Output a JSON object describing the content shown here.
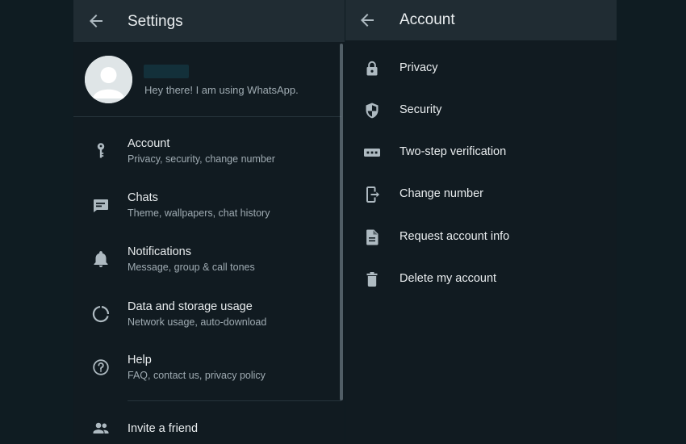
{
  "settings": {
    "title": "Settings",
    "profile": {
      "status": "Hey there! I am using WhatsApp."
    },
    "items": [
      {
        "icon": "key-icon",
        "title": "Account",
        "subtitle": "Privacy, security, change number"
      },
      {
        "icon": "chat-icon",
        "title": "Chats",
        "subtitle": "Theme, wallpapers, chat history"
      },
      {
        "icon": "bell-icon",
        "title": "Notifications",
        "subtitle": "Message, group & call tones"
      },
      {
        "icon": "data-usage-icon",
        "title": "Data and storage usage",
        "subtitle": "Network usage, auto-download"
      },
      {
        "icon": "help-icon",
        "title": "Help",
        "subtitle": "FAQ, contact us, privacy policy"
      }
    ],
    "invite": {
      "icon": "people-icon",
      "title": "Invite a friend"
    }
  },
  "account": {
    "title": "Account",
    "items": [
      {
        "icon": "lock-icon",
        "label": "Privacy"
      },
      {
        "icon": "shield-icon",
        "label": "Security"
      },
      {
        "icon": "dots-icon",
        "label": "Two-step verification"
      },
      {
        "icon": "change-number-icon",
        "label": "Change number"
      },
      {
        "icon": "document-icon",
        "label": "Request account info"
      },
      {
        "icon": "trash-icon",
        "label": "Delete my account"
      }
    ]
  },
  "colors": {
    "background": "#0f1c22",
    "panel": "#111b21",
    "header": "#202c33",
    "primary_text": "#e9edef",
    "secondary_text": "#9fabb2",
    "icon": "#aebac1"
  }
}
